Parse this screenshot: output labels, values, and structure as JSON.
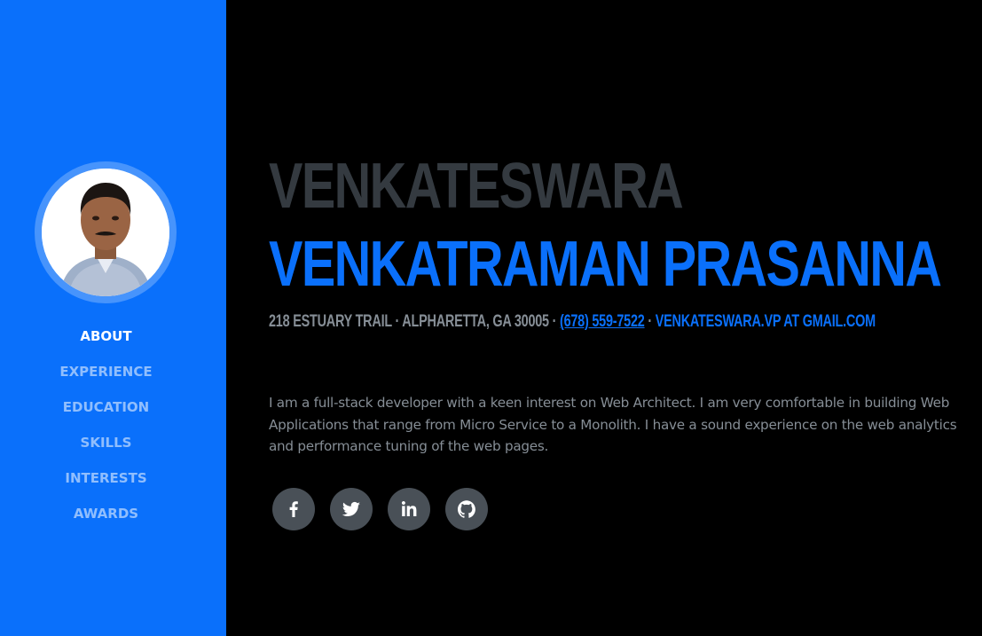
{
  "sidebar": {
    "nav": [
      {
        "label": "ABOUT",
        "active": true
      },
      {
        "label": "EXPERIENCE",
        "active": false
      },
      {
        "label": "EDUCATION",
        "active": false
      },
      {
        "label": "SKILLS",
        "active": false
      },
      {
        "label": "INTERESTS",
        "active": false
      },
      {
        "label": "AWARDS",
        "active": false
      }
    ]
  },
  "about": {
    "first_name": "VENKATESWARA",
    "last_name": "VENKATRAMAN PRASANNA",
    "address": "218 ESTUARY TRAIL · ALPHARETTA, GA 30005 · ",
    "phone": "(678) 559-7522",
    "separator": " · ",
    "email": "VENKATESWARA.VP AT GMAIL.COM",
    "bio": "I am a full-stack developer with a keen interest on Web Architect. I am very comfortable in building Web Applications that range from Micro Service to a Monolith. I have a sound experience on the web analytics and performance tuning of the web pages."
  },
  "social": [
    {
      "icon": "facebook-icon"
    },
    {
      "icon": "twitter-icon"
    },
    {
      "icon": "linkedin-icon"
    },
    {
      "icon": "github-icon"
    }
  ],
  "colors": {
    "primary": "#0a70fb",
    "background": "#000000",
    "heading_dark": "#343a40",
    "muted": "#868e96",
    "social_bg": "#495057"
  }
}
